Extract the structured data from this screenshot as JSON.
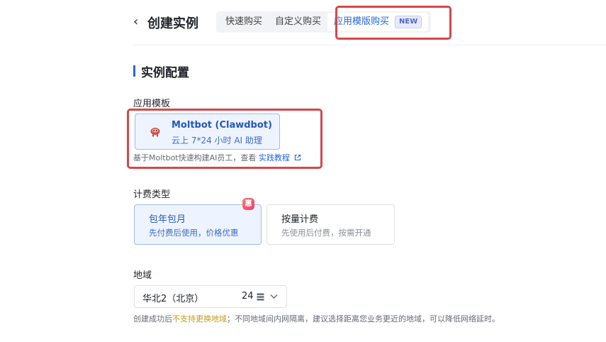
{
  "header": {
    "back_glyph": "‹",
    "title": "创建实例",
    "tabs": [
      {
        "label": "快速购买"
      },
      {
        "label": "自定义购买"
      },
      {
        "label": "应用模版购买",
        "badge": "NEW"
      }
    ]
  },
  "section": {
    "title": "实例配置"
  },
  "app_template": {
    "label": "应用模板",
    "card_name": "Moltbot (Clawdbot)",
    "card_desc": "云上 7*24 小时 AI 助理",
    "icon": "robot-icon",
    "help_prefix": "基于Moltbot快速构建AI员工，查看",
    "help_link": "实践教程"
  },
  "billing": {
    "label": "计费类型",
    "promo_badge": "惠",
    "options": [
      {
        "title": "包年包月",
        "desc": "先付费后使用，价格优惠"
      },
      {
        "title": "按量计费",
        "desc": "先使用后付费，按需开通"
      }
    ]
  },
  "region": {
    "label": "地域",
    "value": "华北2（北京）",
    "zone_count": "24",
    "note_prefix": "创建成功后",
    "note_warn": "不支持更换地域",
    "note_suffix": "；不同地域间内网隔离，建议选择距离您业务更近的地域，可以降低网络延时。"
  },
  "colors": {
    "accent": "#2565d9",
    "highlight": "#d6474a",
    "warning": "#c59a1a"
  }
}
